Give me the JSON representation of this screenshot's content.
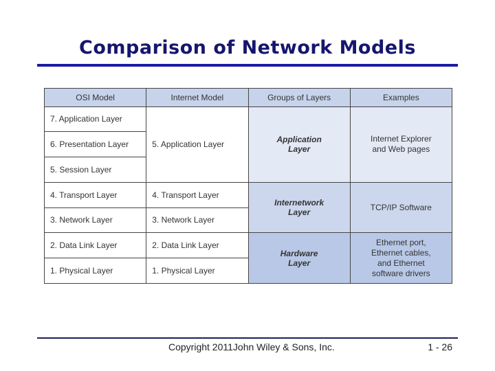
{
  "title": "Comparison of Network Models",
  "table": {
    "headers": [
      "OSI Model",
      "Internet Model",
      "Groups of Layers",
      "Examples"
    ],
    "osi": [
      "7. Application Layer",
      "6. Presentation Layer",
      "5. Session Layer",
      "4. Transport Layer",
      "3. Network Layer",
      "2. Data Link Layer",
      "1. Physical Layer"
    ],
    "internet": [
      "5. Application Layer",
      "4. Transport Layer",
      "3. Network Layer",
      "2. Data Link Layer",
      "1. Physical Layer"
    ],
    "groups": [
      {
        "line1": "Application",
        "line2": "Layer"
      },
      {
        "line1": "Internetwork",
        "line2": "Layer"
      },
      {
        "line1": "Hardware",
        "line2": "Layer"
      }
    ],
    "examples": [
      {
        "lines": [
          "Internet Explorer",
          "and Web pages"
        ]
      },
      {
        "lines": [
          "TCP/IP Software"
        ]
      },
      {
        "lines": [
          "Ethernet port,",
          "Ethernet cables,",
          "and Ethernet",
          "software drivers"
        ]
      }
    ]
  },
  "footer": {
    "copyright": "Copyright 2011John Wiley & Sons, Inc.",
    "page": "1 - 26"
  },
  "colors": {
    "title": "#16166e",
    "title_rule": "#1a1aa6",
    "header_bg": "#c7d3ea",
    "group1_bg": "#e3e9f5",
    "group2_bg": "#ccd7ee",
    "group3_bg": "#b8c8e6"
  }
}
